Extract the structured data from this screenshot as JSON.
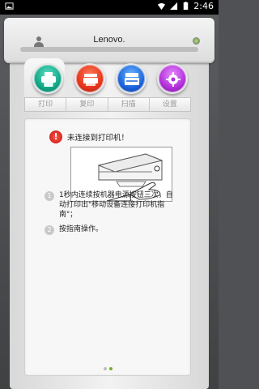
{
  "status_bar": {
    "time": "2:46"
  },
  "header": {
    "brand": "Lenovo."
  },
  "tabs": [
    {
      "label": "打印",
      "icon": "printer-icon"
    },
    {
      "label": "复印",
      "icon": "copy-icon"
    },
    {
      "label": "扫描",
      "icon": "scan-icon"
    },
    {
      "label": "设置",
      "icon": "gear-icon"
    }
  ],
  "panel": {
    "alert_icon": "!",
    "alert_text": "未连接到打印机！",
    "steps": [
      {
        "num": "1",
        "text": "1秒内连续按机器电源按钮三次，自动打印出\"移动设备连接打印机指南\"；"
      },
      {
        "num": "2",
        "text": "按指南操作。"
      }
    ]
  },
  "pager": {
    "count": 2,
    "active_index": 1
  },
  "colors": {
    "print": "#11a686",
    "copy": "#e5331b",
    "scan": "#1b62d9",
    "settings": "#b12ed8",
    "alert": "#c50f0f",
    "page_dot_active": "#6fb12c"
  }
}
